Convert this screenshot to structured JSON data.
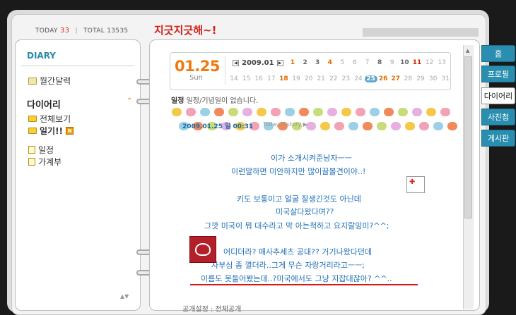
{
  "counter": {
    "today_label": "TODAY",
    "today_value": "33",
    "separator": "|",
    "total_label": "TOTAL",
    "total_value": "13535"
  },
  "page_title": "지긋지긋해~!",
  "left_panel": {
    "diary_label": "DIARY",
    "monthly_calendar": "월간달력",
    "section_title": "다이어리",
    "view_all": "전체보기",
    "diary_entries": "일기!!",
    "new_badge": "N",
    "schedule": "일정",
    "ledger": "가계부",
    "scroll_glyph": "▲▼"
  },
  "calendar": {
    "big_date": "01.25",
    "big_day": "Sun",
    "month": "2009.01",
    "prev": "◀",
    "next": "▶",
    "days": [
      {
        "d": "1",
        "s": "orange"
      },
      {
        "d": "2",
        "s": "dark"
      },
      {
        "d": "3",
        "s": "dark"
      },
      {
        "d": "4",
        "s": "orange"
      },
      {
        "d": "5",
        "s": ""
      },
      {
        "d": "6",
        "s": ""
      },
      {
        "d": "7",
        "s": ""
      },
      {
        "d": "8",
        "s": "dark"
      },
      {
        "d": "9",
        "s": ""
      },
      {
        "d": "10",
        "s": "dark"
      },
      {
        "d": "11",
        "s": "red"
      },
      {
        "d": "12",
        "s": ""
      },
      {
        "d": "13",
        "s": ""
      },
      {
        "d": "14",
        "s": ""
      },
      {
        "d": "15",
        "s": ""
      },
      {
        "d": "16",
        "s": ""
      },
      {
        "d": "17",
        "s": ""
      },
      {
        "d": "18",
        "s": "orange"
      },
      {
        "d": "19",
        "s": ""
      },
      {
        "d": "20",
        "s": ""
      },
      {
        "d": "21",
        "s": ""
      },
      {
        "d": "22",
        "s": ""
      },
      {
        "d": "23",
        "s": ""
      },
      {
        "d": "24",
        "s": ""
      },
      {
        "d": "25",
        "s": "today"
      },
      {
        "d": "26",
        "s": "orange"
      },
      {
        "d": "27",
        "s": "orange"
      },
      {
        "d": "28",
        "s": ""
      },
      {
        "d": "29",
        "s": ""
      },
      {
        "d": "30",
        "s": ""
      },
      {
        "d": "31",
        "s": ""
      }
    ]
  },
  "schedule_line": {
    "label": "일정",
    "text": "일정/기념일이 없습니다."
  },
  "post": {
    "date": "2009.01.25 일  00:31",
    "history": "Today History ▶",
    "lines": [
      "이가 소개시켜준남자ㅡㅡ",
      "이런말하면 미안하지만 많이끌볼견이야..!",
      "키도 보통이고 얼굴 잘생긴것도 아닌데",
      "미국살다왔다며??",
      "그깟 미국이 뭐 대수라고 막 아는척하고 요지랄잉미?^^;",
      "어디더라? 매사추세츠 공대?? 거기나왔다던데",
      "자부심 좀 껼더라..그게 무슨 자랑거리라고ㅡㅡ;",
      "이름도 못들어봤는데..?미국에서도 그냥 지잡대잖아? ^^.."
    ]
  },
  "footer": "공개설정 : 전체공개",
  "side_tabs": [
    {
      "label": "홈",
      "active": false
    },
    {
      "label": "프로필",
      "active": false
    },
    {
      "label": "다이어리",
      "active": true
    },
    {
      "label": "사진첩",
      "active": false
    },
    {
      "label": "게시판",
      "active": false
    }
  ],
  "colors": {
    "accent_blue": "#2a8eb0",
    "accent_orange": "#f07a10",
    "title_red": "#d0201a",
    "text_blue": "#1f6fb8"
  }
}
